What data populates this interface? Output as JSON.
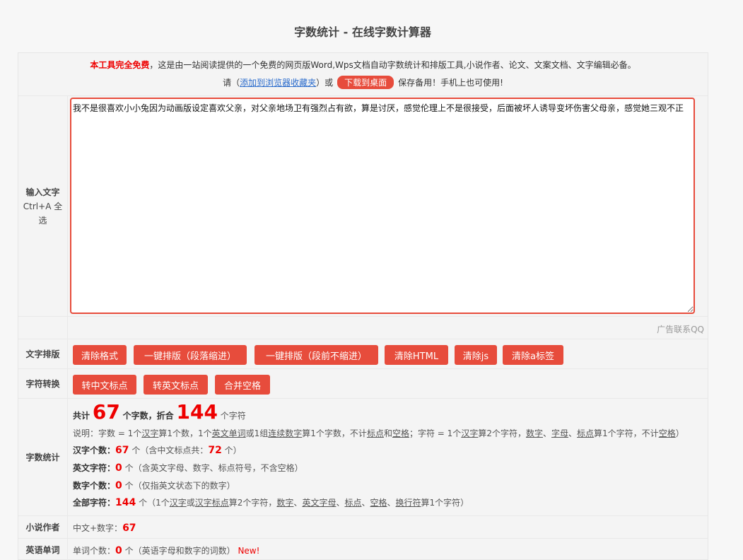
{
  "page": {
    "title": "字数统计 - 在线字数计算器"
  },
  "intro": {
    "free": "本工具完全免费",
    "desc": "，这是由一站阅读提供的一个免费的网页版Word,Wps文档自动字数统计和排版工具,小说作者、论文、文案文档、文字编辑必备。",
    "please": "请（",
    "bookmark_link": "添加到浏览器收藏夹",
    "or": "）或",
    "download_btn": "下载到桌面",
    "save": "保存备用！手机上也可使用!"
  },
  "input": {
    "label_title": "输入文字",
    "label_hint": "Ctrl+A 全选",
    "text": "我不是很喜欢小小兔因为动画版设定喜欢父亲，对父亲地场卫有强烈占有欲，算是讨厌，感觉伦理上不是很接受，后面被坏人诱导变坏伤害父母亲，感觉她三观不正"
  },
  "ad": {
    "text": "广告联系QQ"
  },
  "format": {
    "label": "文字排版",
    "buttons": [
      "清除格式",
      "一键排版（段落缩进）",
      "一键排版（段前不缩进）",
      "清除HTML",
      "清除js",
      "清除a标签"
    ]
  },
  "convert": {
    "label": "字符转换",
    "buttons": [
      "转中文标点",
      "转英文标点",
      "合并空格"
    ]
  },
  "stats": {
    "label": "字数统计",
    "total_prefix": "共计",
    "total_words": "67",
    "total_words_unit": "个字数，折合",
    "total_chars": "144",
    "total_chars_unit": "个字符",
    "explain": {
      "a": "说明：字数 = 1个",
      "hanzi": "汉字",
      "b": "算1个数，1个",
      "eng_word": "英文单词",
      "c": "或1组",
      "cont_num": "连续数字",
      "d": "算1个字数，不计",
      "punct": "标点",
      "e": "和",
      "space": "空格",
      "f": "；字符 = 1个",
      "hanzi2": "汉字",
      "g": "算2个字符，",
      "digit": "数字",
      "h": "、",
      "letter": "字母",
      "i": "、",
      "punct2": "标点",
      "j": "算1个字符，不计",
      "space2": "空格",
      "k": "）"
    },
    "hanzi": {
      "label": "汉字个数：",
      "value": "67",
      "unit": "个（含中文标点共：",
      "punct_value": "72",
      "end": "个）"
    },
    "english": {
      "label": "英文字符：",
      "value": "0",
      "rest": "个（含英文字母、数字、标点符号，不含空格）"
    },
    "digits": {
      "label": "数字个数：",
      "value": "0",
      "rest": "个（仅指英文状态下的数字）"
    },
    "all": {
      "label": "全部字符：",
      "value": "144",
      "a": "个（1个",
      "hanzi": "汉字",
      "b": "或",
      "hanzi_punct": "汉字标点",
      "c": "算2个字符，",
      "digit": "数字",
      "d": "、",
      "eng_letter": "英文字母",
      "e": "、",
      "punct": "标点",
      "f": "、",
      "space": "空格",
      "g": "、",
      "newline": "换行符",
      "h": "算1个字符）"
    }
  },
  "novel": {
    "label": "小说作者",
    "text": "中文+数字：",
    "value": "67"
  },
  "words": {
    "label": "英语单词",
    "text": "单词个数：",
    "value": "0",
    "rest": "个（英语字母和数字的词数）",
    "new": "New!"
  }
}
